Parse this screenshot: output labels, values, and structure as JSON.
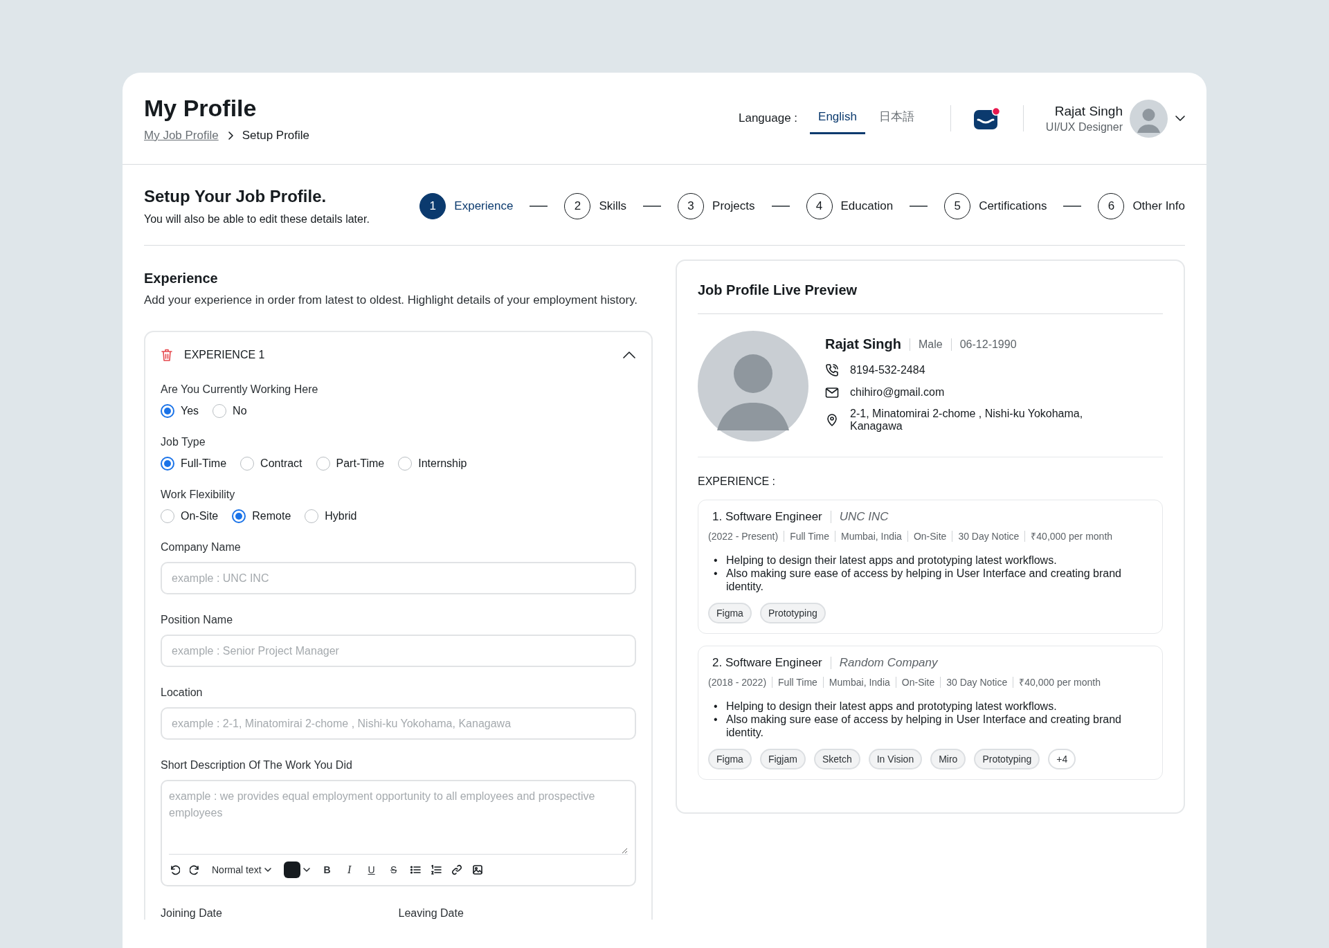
{
  "header": {
    "title": "My Profile",
    "breadcrumb": [
      {
        "label": "My Job Profile",
        "kind": "link"
      },
      {
        "label": "Setup Profile",
        "kind": "current"
      }
    ],
    "language_label": "Language :",
    "languages": [
      {
        "label": "English",
        "selected": true
      },
      {
        "label": "日本語",
        "selected": false
      }
    ],
    "notification": {
      "unread": true
    },
    "user": {
      "name": "Rajat Singh",
      "role": "UI/UX Designer"
    }
  },
  "setup": {
    "title": "Setup Your Job Profile.",
    "subtitle": "You will also be able to edit these details later.",
    "steps": [
      {
        "number": "1",
        "label": "Experience",
        "selected": true
      },
      {
        "number": "2",
        "label": "Skills",
        "selected": false
      },
      {
        "number": "3",
        "label": "Projects",
        "selected": false
      },
      {
        "number": "4",
        "label": "Education",
        "selected": false
      },
      {
        "number": "5",
        "label": "Certifications",
        "selected": false
      },
      {
        "number": "6",
        "label": "Other Info",
        "selected": false
      }
    ]
  },
  "form": {
    "title": "Experience",
    "description": "Add your experience in order from latest to oldest. Highlight details of your employment history.",
    "section": {
      "title": "EXPERIENCE 1",
      "expanded": true,
      "radio_groups": [
        {
          "label": "Are You Currently Working Here",
          "options": [
            {
              "label": "Yes",
              "selected": true
            },
            {
              "label": "No",
              "selected": false
            }
          ]
        },
        {
          "label": "Job Type",
          "options": [
            {
              "label": "Full-Time",
              "selected": true
            },
            {
              "label": "Contract",
              "selected": false
            },
            {
              "label": "Part-Time",
              "selected": false
            },
            {
              "label": "Internship",
              "selected": false
            }
          ]
        },
        {
          "label": "Work Flexibility",
          "options": [
            {
              "label": "On-Site",
              "selected": false
            },
            {
              "label": "Remote",
              "selected": true
            },
            {
              "label": "Hybrid",
              "selected": false
            }
          ]
        }
      ],
      "fields": [
        {
          "label": "Company Name",
          "placeholder": "example : UNC INC",
          "kind": "input"
        },
        {
          "label": "Position Name",
          "placeholder": "example : Senior Project Manager",
          "kind": "input"
        },
        {
          "label": "Location",
          "placeholder": "example : 2-1, Minatomirai 2-chome , Nishi-ku Yokohama, Kanagawa",
          "kind": "input"
        },
        {
          "label": "Short Description Of The Work You Did",
          "placeholder": "example : we provides equal employment opportunity to all employees and prospective employees",
          "kind": "textarea"
        }
      ],
      "editor_toolbar": {
        "text_style": "Normal text",
        "format_buttons": [
          {
            "glyph": "B",
            "kind": "bold"
          },
          {
            "glyph": "I",
            "kind": "italic"
          },
          {
            "glyph": "U",
            "kind": "underline"
          },
          {
            "glyph": "S",
            "kind": "strike"
          }
        ]
      },
      "date_labels": [
        "Joining Date",
        "Leaving Date"
      ]
    }
  },
  "preview": {
    "title": "Job Profile Live Preview",
    "person": {
      "name": "Rajat Singh",
      "gender": "Male",
      "birth_date": "06-12-1990",
      "phone": "8194-532-2484",
      "email": "chihiro@gmail.com",
      "address": "2-1, Minatomirai 2-chome , Nishi-ku Yokohama, Kanagawa"
    },
    "experience_label": "EXPERIENCE :",
    "bullet_marker": "•",
    "experiences": [
      {
        "heading": "1. Software Engineer",
        "company": "UNC INC",
        "meta": [
          "(2022 - Present)",
          "Full Time",
          "Mumbai, India",
          "On-Site",
          "30 Day Notice",
          "₹40,000 per month"
        ],
        "bullets": [
          "Helping to design their latest apps and prototyping latest workflows.",
          "Also making sure ease of access by helping in User Interface and creating brand identity."
        ],
        "tags": [
          {
            "label": "Figma",
            "kind": "skill"
          },
          {
            "label": "Prototyping",
            "kind": "skill"
          }
        ]
      },
      {
        "heading": "2. Software Engineer",
        "company": "Random Company",
        "meta": [
          "(2018 - 2022)",
          "Full Time",
          "Mumbai, India",
          "On-Site",
          "30 Day Notice",
          "₹40,000 per month"
        ],
        "bullets": [
          "Helping to design their latest apps and prototyping latest workflows.",
          "Also making sure ease of access by helping in User Interface and creating brand identity."
        ],
        "tags": [
          {
            "label": "Figma",
            "kind": "skill"
          },
          {
            "label": "Figjam",
            "kind": "skill"
          },
          {
            "label": "Sketch",
            "kind": "skill"
          },
          {
            "label": "In Vision",
            "kind": "skill"
          },
          {
            "label": "Miro",
            "kind": "skill"
          },
          {
            "label": "Prototyping",
            "kind": "skill"
          },
          {
            "label": "+4",
            "kind": "more"
          }
        ]
      }
    ]
  }
}
